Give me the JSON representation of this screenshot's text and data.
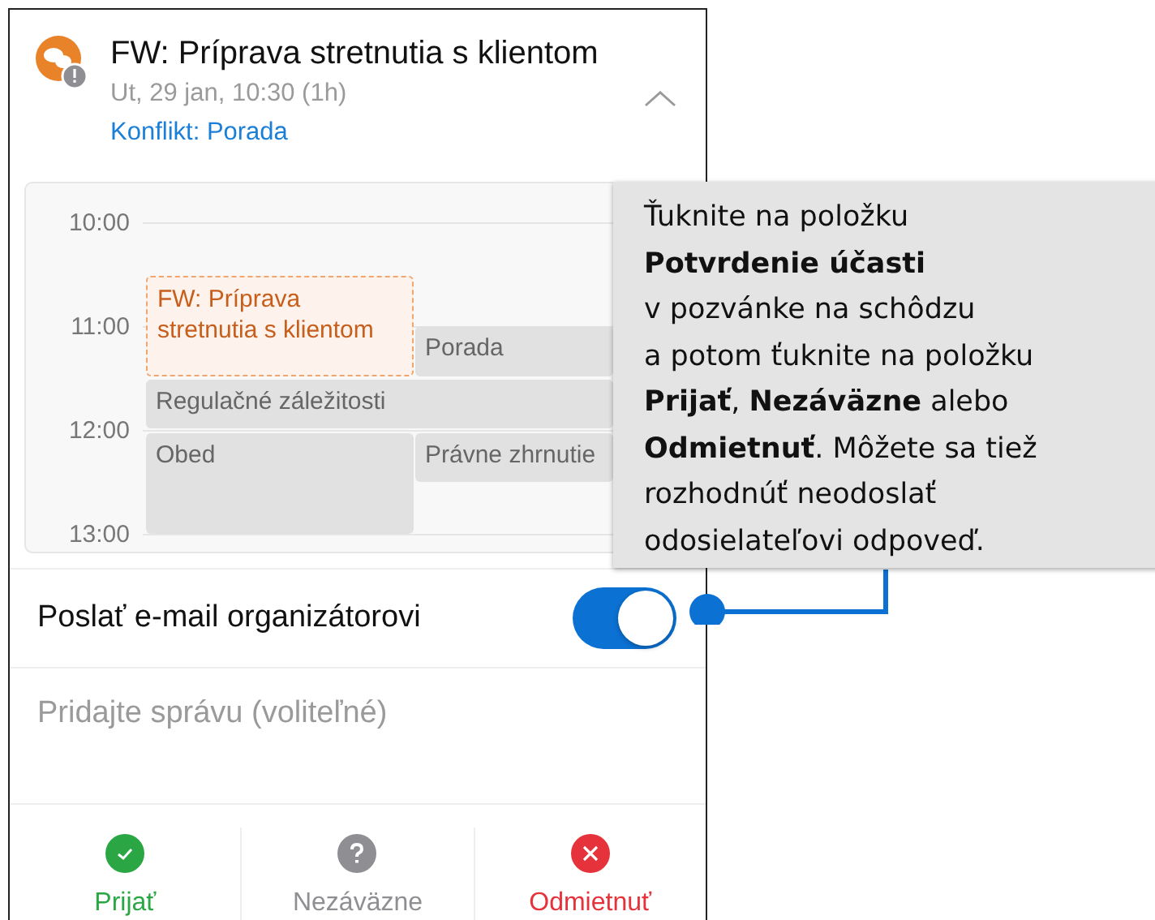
{
  "event": {
    "title": "FW: Príprava stretnutia s klientom",
    "when": "Ut, 29 jan, 10:30 (1h)",
    "conflict": "Konflikt: Porada",
    "expanded": true
  },
  "calendar": {
    "times": [
      "10:00",
      "11:00",
      "12:00",
      "13:00"
    ],
    "events": [
      {
        "title": "FW: Príprava stretnutia s klientom",
        "kind": "pending"
      },
      {
        "title": "Porada",
        "kind": "busy"
      },
      {
        "title": "Regulačné záležitosti",
        "kind": "busy"
      },
      {
        "title": "Obed",
        "kind": "busy"
      },
      {
        "title": "Právne zhrnutie",
        "kind": "busy"
      }
    ]
  },
  "send_email": {
    "label": "Poslať e-mail organizátorovi",
    "on": true
  },
  "message": {
    "placeholder": "Pridajte správu (voliteľné)"
  },
  "actions": [
    {
      "label": "Prijať",
      "kind": "accept"
    },
    {
      "label": "Nezáväzne",
      "kind": "tentative"
    },
    {
      "label": "Odmietnuť",
      "kind": "decline"
    }
  ],
  "callout": {
    "text": "Ťuknite na položku\n**Potvrdenie účasti**\nv pozvánke na schôdzu\na potom ťuknite na položku\n**Prijať**, **Nezáväzne** alebo\n**Odmietnuť**. Môžete sa tiež\nrozhodnúť neodoslať\nodosielateľovi odpoveď."
  }
}
